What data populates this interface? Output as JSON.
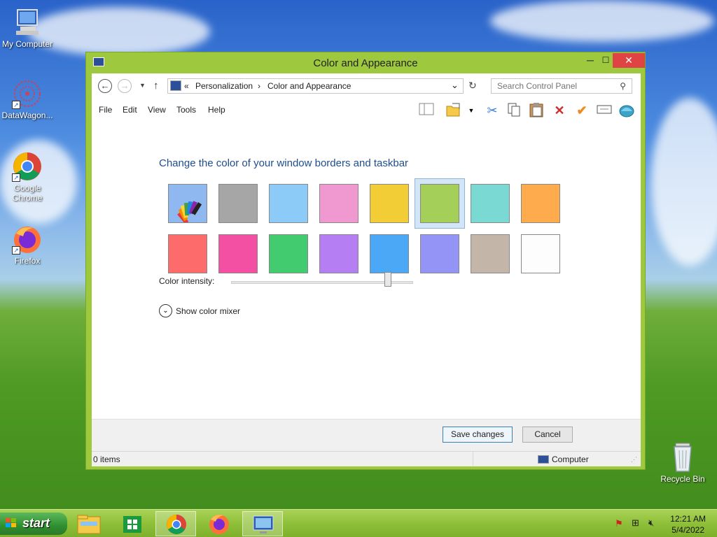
{
  "desktop": {
    "icons": [
      {
        "label": "My Computer"
      },
      {
        "label": "DataWagon..."
      },
      {
        "label": "Google Chrome"
      },
      {
        "label": "Firefox"
      },
      {
        "label": "Recycle Bin"
      }
    ]
  },
  "window": {
    "title": "Color and Appearance",
    "buttons": {
      "minimize": "─",
      "maximize": "☐",
      "close": "✕"
    }
  },
  "address": {
    "separator": "«",
    "crumbs": [
      "Personalization",
      "Color and Appearance"
    ],
    "arrow": "›",
    "search_placeholder": "Search Control Panel"
  },
  "menu": {
    "file": "File",
    "edit": "Edit",
    "view": "View",
    "tools": "Tools",
    "help": "Help"
  },
  "main": {
    "heading": "Change the color of your window borders and taskbar",
    "swatches": [
      {
        "color": "custom",
        "selected": false
      },
      {
        "color": "#a6a6a6",
        "selected": false
      },
      {
        "color": "#8ccaf7",
        "selected": false
      },
      {
        "color": "#f099d1",
        "selected": false
      },
      {
        "color": "#f3cd35",
        "selected": false
      },
      {
        "color": "#a4d05a",
        "selected": true
      },
      {
        "color": "#7bd9d3",
        "selected": false
      },
      {
        "color": "#feab4e",
        "selected": false
      },
      {
        "color": "#fd6b6b",
        "selected": false
      },
      {
        "color": "#f34fa3",
        "selected": false
      },
      {
        "color": "#43cb70",
        "selected": false
      },
      {
        "color": "#b57ef2",
        "selected": false
      },
      {
        "color": "#4aa8f7",
        "selected": false
      },
      {
        "color": "#9494f7",
        "selected": false
      },
      {
        "color": "#c3b5a7",
        "selected": false
      },
      {
        "color": "#fdfdfd",
        "selected": false
      }
    ],
    "intensity_label": "Color intensity:",
    "intensity_value": 0.86,
    "mixer_label": "Show color mixer"
  },
  "actions": {
    "save": "Save changes",
    "cancel": "Cancel"
  },
  "status": {
    "items": "0 items",
    "location": "Computer"
  },
  "taskbar": {
    "start": "start",
    "time": "12:21 AM",
    "date": "5/4/2022"
  },
  "colors": {
    "window_frame": "#9ec93e",
    "close_red": "#e04343",
    "heading_blue": "#1e4e8c"
  }
}
